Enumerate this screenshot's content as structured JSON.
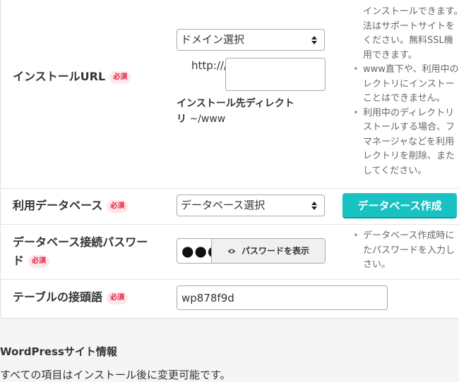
{
  "install_url": {
    "label": "インストールURL",
    "required_badge": "必須",
    "domain_select_value": "ドメイン選択",
    "protocol_prefix": "http:///",
    "directory_input_value": "",
    "directory_label": "インストール先ディレクトリ",
    "directory_suffix": "~/www",
    "notes": [
      {
        "bullet": false,
        "lines": [
          "インストールできます。"
        ]
      },
      {
        "bullet": false,
        "lines": [
          "法はサポートサイトを"
        ]
      },
      {
        "bullet": false,
        "lines": [
          "ください。無料SSL機"
        ]
      },
      {
        "bullet": false,
        "lines": [
          "用できます。"
        ]
      },
      {
        "bullet": true,
        "lines": [
          "www直下や、利用中の"
        ]
      },
      {
        "bullet": false,
        "lines": [
          "レクトリにインストー"
        ]
      },
      {
        "bullet": false,
        "lines": [
          "ことはできません。"
        ]
      },
      {
        "bullet": true,
        "lines": [
          "利用中のディレクトリ"
        ]
      },
      {
        "bullet": false,
        "lines": [
          "ストールする場合、フ"
        ]
      },
      {
        "bullet": false,
        "lines": [
          "マネージャなどを利用"
        ]
      },
      {
        "bullet": false,
        "lines": [
          "レクトリを削除、また"
        ]
      },
      {
        "bullet": false,
        "lines": [
          "してください。"
        ]
      }
    ]
  },
  "database": {
    "label": "利用データベース",
    "required_badge": "必須",
    "select_value": "データベース選択",
    "create_button": "データベース作成"
  },
  "db_password": {
    "label_line1": "データベース接続パスワー",
    "label_line2": "ド",
    "required_badge": "必須",
    "masked_value": "●●●",
    "show_button": "パスワードを表示",
    "notes": [
      {
        "bullet": true,
        "text": "データベース作成時に"
      },
      {
        "bullet": false,
        "text": "たパスワードを入力し"
      },
      {
        "bullet": false,
        "text": "さい。"
      }
    ]
  },
  "table_prefix": {
    "label": "テーブルの接頭語",
    "required_badge": "必須",
    "value": "wp878f9d"
  },
  "site_info": {
    "title": "WordPressサイト情報",
    "note": "すべての項目はインストール後に変更可能です。"
  }
}
